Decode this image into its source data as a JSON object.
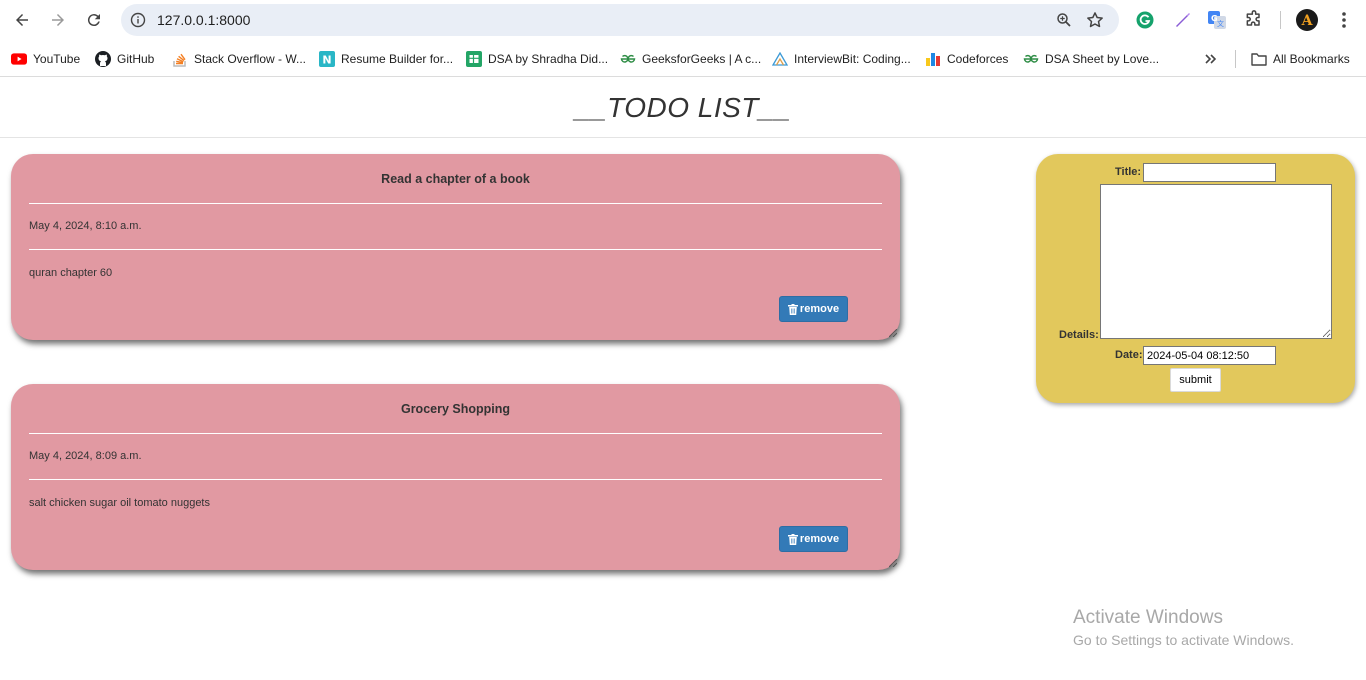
{
  "browser": {
    "url": "127.0.0.1:8000",
    "bookmarks": [
      {
        "label": "YouTube",
        "icon": "youtube-icon"
      },
      {
        "label": "GitHub",
        "icon": "github-icon"
      },
      {
        "label": "Stack Overflow - W...",
        "icon": "stackoverflow-icon"
      },
      {
        "label": "Resume Builder for...",
        "icon": "resume-builder-icon"
      },
      {
        "label": "DSA by Shradha Did...",
        "icon": "google-sheets-icon"
      },
      {
        "label": "GeeksforGeeks | A c...",
        "icon": "geeksforgeeks-icon"
      },
      {
        "label": "InterviewBit: Coding...",
        "icon": "interviewbit-icon"
      },
      {
        "label": "Codeforces",
        "icon": "codeforces-icon"
      },
      {
        "label": "DSA Sheet by Love...",
        "icon": "geeksforgeeks-icon"
      }
    ],
    "all_bookmarks_label": "All Bookmarks",
    "profile_initial": "A"
  },
  "page": {
    "title": "__TODO LIST__"
  },
  "todos": [
    {
      "title": "Read a chapter of a book",
      "date": "May 4, 2024, 8:10 a.m.",
      "details": "quran chapter 60",
      "remove_label": "remove"
    },
    {
      "title": "Grocery Shopping",
      "date": "May 4, 2024, 8:09 a.m.",
      "details": "salt chicken sugar oil tomato nuggets",
      "remove_label": "remove"
    }
  ],
  "form": {
    "title_label": "Title:",
    "title_value": "",
    "details_label": "Details:",
    "details_value": "",
    "date_label": "Date:",
    "date_value": "2024-05-04 08:12:50",
    "submit_label": "submit"
  },
  "watermark": {
    "title": "Activate Windows",
    "subtitle": "Go to Settings to activate Windows."
  },
  "colors": {
    "card_bg": "#e199a2",
    "form_bg": "#e2c85c",
    "remove_btn": "#337ab7"
  }
}
